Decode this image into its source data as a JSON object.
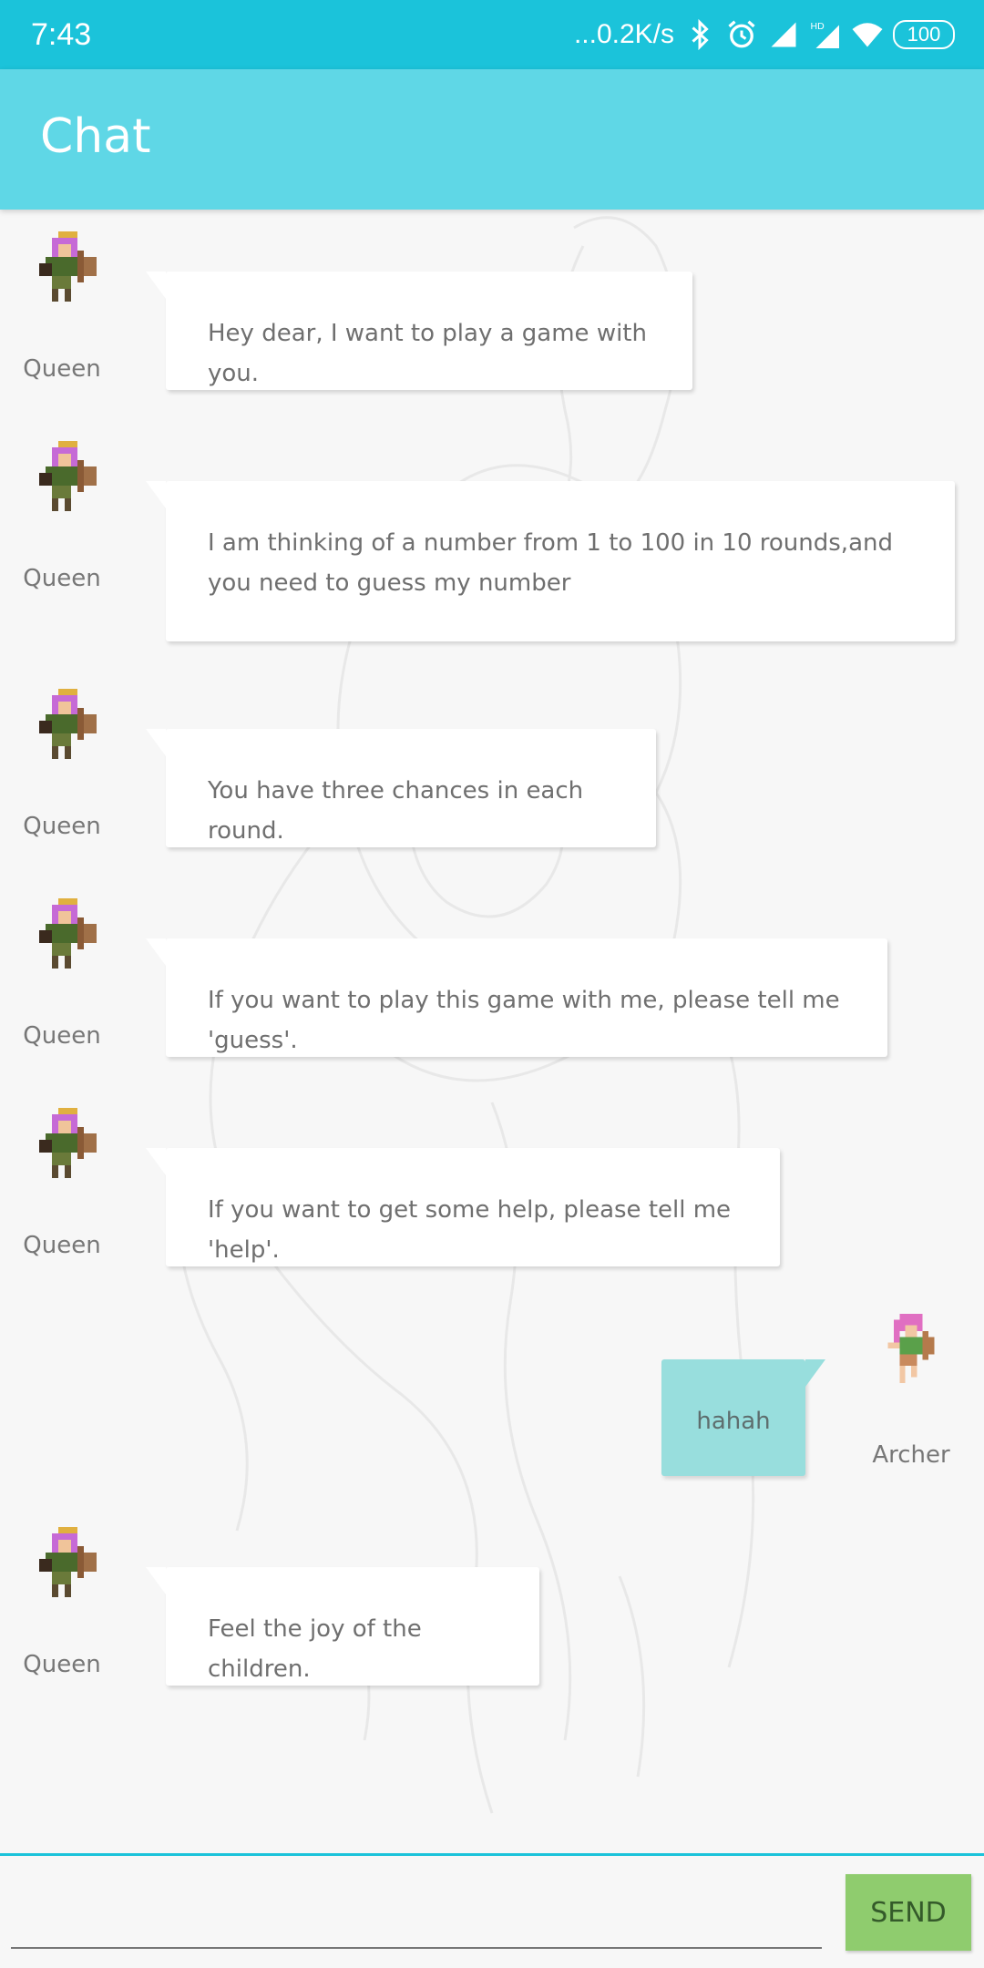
{
  "status_bar": {
    "time": "7:43",
    "network_speed": "...0.2K/s",
    "hd_label": "HD",
    "battery": "100",
    "icons": [
      "bluetooth-icon",
      "alarm-icon",
      "signal-icon",
      "hd-signal-icon",
      "wifi-icon",
      "battery-icon"
    ]
  },
  "app_bar": {
    "title": "Chat"
  },
  "messages": [
    {
      "side": "left",
      "sender": "Queen",
      "avatar": "queen-avatar",
      "text": "Hey dear, I want to play a game with you."
    },
    {
      "side": "left",
      "sender": "Queen",
      "avatar": "queen-avatar",
      "text": "I am thinking of a number from 1 to 100 in 10 rounds,and you need to guess my number"
    },
    {
      "side": "left",
      "sender": "Queen",
      "avatar": "queen-avatar",
      "text": "You have three chances in each round."
    },
    {
      "side": "left",
      "sender": "Queen",
      "avatar": "queen-avatar",
      "text": "If you want to play this game with me, please tell me 'guess'."
    },
    {
      "side": "left",
      "sender": "Queen",
      "avatar": "queen-avatar",
      "text": "If you want to get some help, please tell me 'help'."
    },
    {
      "side": "right",
      "sender": "Archer",
      "avatar": "archer-avatar",
      "text": "hahah"
    },
    {
      "side": "left",
      "sender": "Queen",
      "avatar": "queen-avatar",
      "text": "Feel the joy of the children."
    }
  ],
  "input": {
    "value": "",
    "placeholder": ""
  },
  "send_button": {
    "label": "SEND"
  },
  "colors": {
    "status_bar": "#1bc3da",
    "app_bar": "#5fd7e6",
    "background": "#f7f7f7",
    "bubble_incoming": "#ffffff",
    "bubble_outgoing": "#98dedd",
    "send_button": "#8fcc6e"
  }
}
